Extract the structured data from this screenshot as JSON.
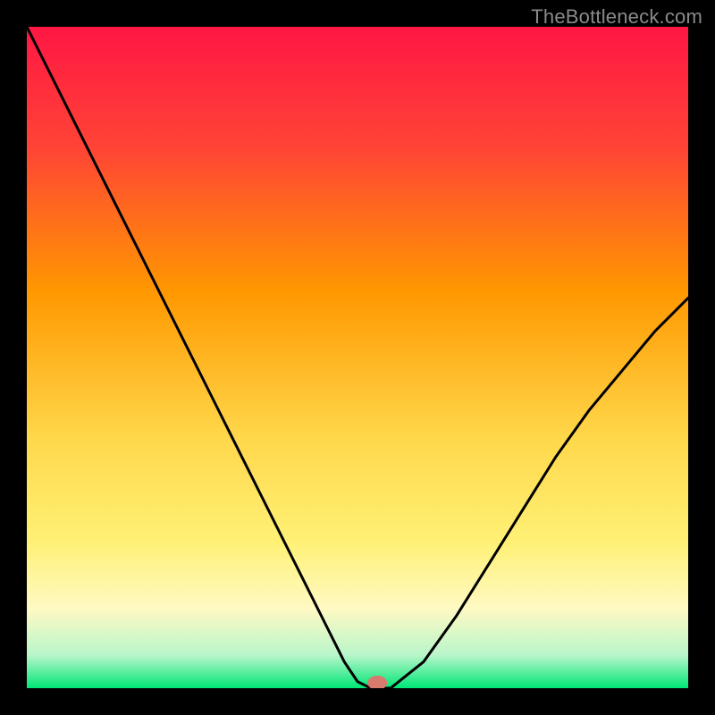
{
  "watermark": "TheBottleneck.com",
  "gradient_colors": {
    "stops": [
      {
        "offset": "0%",
        "color": "#ff1744"
      },
      {
        "offset": "18%",
        "color": "#ff4336"
      },
      {
        "offset": "40%",
        "color": "#ff9800"
      },
      {
        "offset": "62%",
        "color": "#ffd74a"
      },
      {
        "offset": "78%",
        "color": "#fff176"
      },
      {
        "offset": "88%",
        "color": "#fff9c4"
      },
      {
        "offset": "95%",
        "color": "#b9f6ca"
      },
      {
        "offset": "100%",
        "color": "#00e676"
      }
    ]
  },
  "marker_color": "#d97a6f",
  "chart_data": {
    "type": "line",
    "title": "",
    "xlabel": "",
    "ylabel": "",
    "xlim": [
      0,
      100
    ],
    "ylim": [
      0,
      100
    ],
    "x": [
      0,
      5,
      10,
      15,
      20,
      25,
      30,
      35,
      40,
      45,
      48,
      50,
      52,
      53,
      55,
      60,
      65,
      70,
      75,
      80,
      85,
      90,
      95,
      100
    ],
    "values": [
      100,
      90,
      80,
      70,
      60,
      50,
      40,
      30,
      20,
      10,
      4,
      1,
      0,
      0,
      0,
      4,
      11,
      19,
      27,
      35,
      42,
      48,
      54,
      59
    ],
    "optimal_point": {
      "x": 53,
      "y": 0
    }
  }
}
